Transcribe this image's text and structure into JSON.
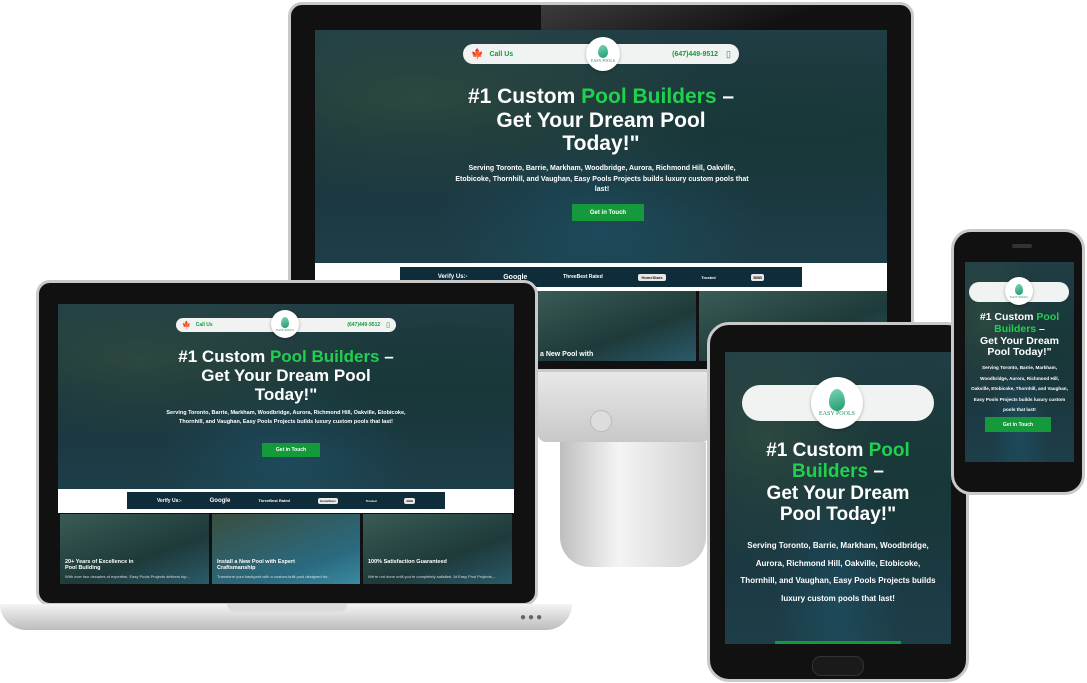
{
  "brand": {
    "name": "EASY POOLS",
    "accent": "#1fd14e",
    "cta_color": "#159a3b",
    "verify_bg": "#0f2c3a"
  },
  "header": {
    "call_label": "Call Us",
    "phone": "(647)449-9512",
    "flag_icon": "canada-flag-icon",
    "phone_icon": "phone-icon"
  },
  "hero": {
    "title_prefix": "#1 Custom ",
    "title_highlight": "Pool Builders",
    "title_dash": " –",
    "title_line2": "Get Your Dream Pool",
    "title_line3": "Today!\"",
    "tablet_title_line1": "#1 Custom ",
    "tablet_highlight_a": "Pool",
    "tablet_highlight_b": "Builders",
    "tablet_line3": "Get Your Dream",
    "tablet_line4": "Pool Today!\"",
    "phone_line1": "#1 Custom ",
    "phone_highlight_a": "Pool",
    "phone_highlight_b": "Builders",
    "phone_line3": "Get Your Dream",
    "phone_line4": "Pool Today!\"",
    "subtitle": "Serving Toronto, Barrie, Markham, Woodbridge, Aurora, Richmond Hill, Oakville, Etobicoke, Thornhill, and Vaughan, Easy Pools Projects builds luxury custom pools that last!",
    "cta_label": "Get in Touch"
  },
  "verify": {
    "label": "Verify Us:-",
    "google": "Google",
    "threebest": "ThreeBest Rated",
    "homestars": "HomeStars",
    "trusted": "Trusted",
    "bbb": "BBB"
  },
  "cards": [
    {
      "title": "20+ Years of Excellence in Pool Building",
      "text": "With over two decades of expertise, Easy Pools Projects delivers top..."
    },
    {
      "title": "Install a New Pool with Expert Craftsmanship",
      "text": "Transform your backyard with a custom-built pool designed for..."
    },
    {
      "title": "100% Satisfaction Guaranteed",
      "text": "We're not done until you're completely satisfied. At Easy Pool Projects,..."
    }
  ],
  "monitor_card_text": "a New Pool with"
}
